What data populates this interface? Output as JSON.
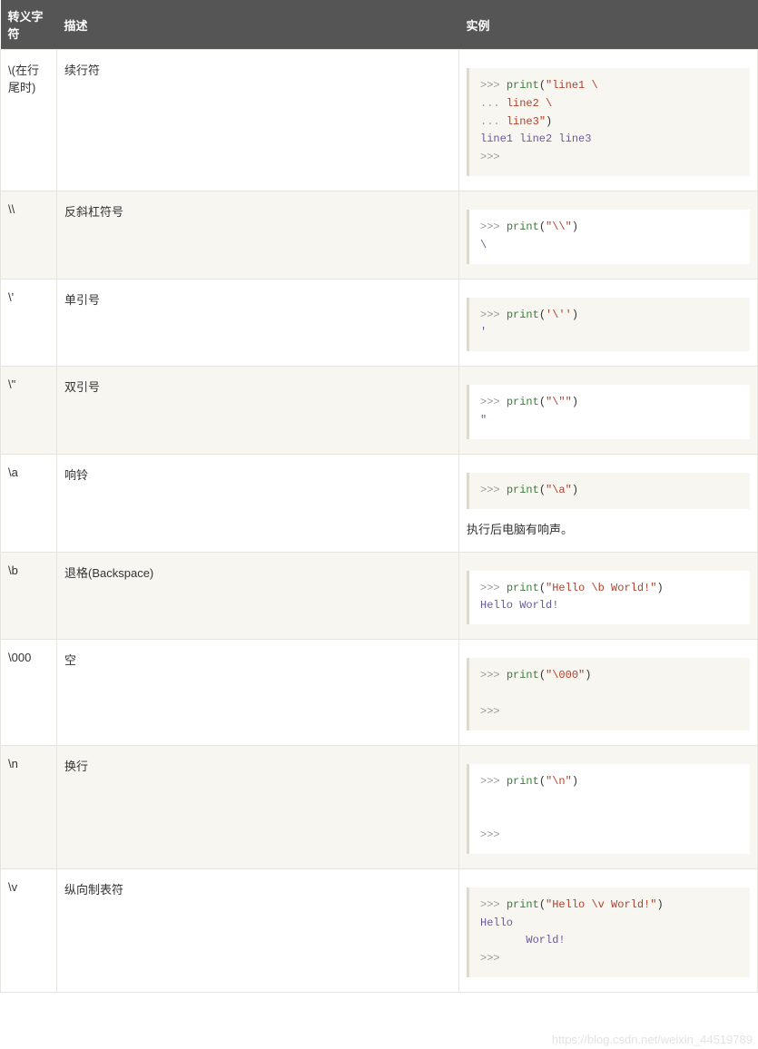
{
  "headers": {
    "c1": "转义字符",
    "c2": "描述",
    "c3": "实例"
  },
  "rows": [
    {
      "esc": "\\(在行尾时)",
      "desc": "续行符",
      "code_html": "<span class=\"tok-prompt\">&gt;&gt;&gt;</span> <span class=\"tok-fn\">print</span>(<span class=\"tok-str\">\"line1 \\</span>\n<span class=\"tok-prompt\">...</span> <span class=\"tok-str\">line2 \\</span>\n<span class=\"tok-prompt\">...</span> <span class=\"tok-str\">line3\"</span>)\n<span class=\"tok-out\">line1 line2 line3</span>\n<span class=\"tok-prompt\">&gt;&gt;&gt;</span> ",
      "note": ""
    },
    {
      "esc": "\\\\",
      "desc": "反斜杠符号",
      "code_html": "<span class=\"tok-prompt\">&gt;&gt;&gt;</span> <span class=\"tok-fn\">print</span>(<span class=\"tok-str\">\"\\\\\"</span>)\n<span class=\"tok-out\">\\</span>",
      "note": ""
    },
    {
      "esc": "\\'",
      "desc": "单引号",
      "code_html": "<span class=\"tok-prompt\">&gt;&gt;&gt;</span> <span class=\"tok-fn\">print</span>(<span class=\"tok-str\">'\\''</span>)\n<span class=\"tok-out\">'</span>",
      "note": ""
    },
    {
      "esc": "\\\"",
      "desc": "双引号",
      "code_html": "<span class=\"tok-prompt\">&gt;&gt;&gt;</span> <span class=\"tok-fn\">print</span>(<span class=\"tok-str\">\"\\\"\"</span>)\n<span class=\"tok-out\">\"</span>",
      "note": ""
    },
    {
      "esc": "\\a",
      "desc": "响铃",
      "code_html": "<span class=\"tok-prompt\">&gt;&gt;&gt;</span> <span class=\"tok-fn\">print</span>(<span class=\"tok-str\">\"\\a\"</span>)",
      "note": "执行后电脑有响声。"
    },
    {
      "esc": "\\b",
      "desc": "退格(Backspace)",
      "code_html": "<span class=\"tok-prompt\">&gt;&gt;&gt;</span> <span class=\"tok-fn\">print</span>(<span class=\"tok-str\">\"Hello \\b World!\"</span>)\n<span class=\"tok-out\">Hello World!</span>",
      "note": ""
    },
    {
      "esc": "\\000",
      "desc": "空",
      "code_html": "<span class=\"tok-prompt\">&gt;&gt;&gt;</span> <span class=\"tok-fn\">print</span>(<span class=\"tok-str\">\"\\000\"</span>)\n\n<span class=\"tok-prompt\">&gt;&gt;&gt;</span> ",
      "note": ""
    },
    {
      "esc": "\\n",
      "desc": "换行",
      "code_html": "<span class=\"tok-prompt\">&gt;&gt;&gt;</span> <span class=\"tok-fn\">print</span>(<span class=\"tok-str\">\"\\n\"</span>)\n\n\n<span class=\"tok-prompt\">&gt;&gt;&gt;</span> ",
      "note": ""
    },
    {
      "esc": "\\v",
      "desc": "纵向制表符",
      "code_html": "<span class=\"tok-prompt\">&gt;&gt;&gt;</span> <span class=\"tok-fn\">print</span>(<span class=\"tok-str\">\"Hello \\v World!\"</span>)\n<span class=\"tok-out\">Hello</span>\n<span class=\"tok-out\">       World!</span>\n<span class=\"tok-prompt\">&gt;&gt;&gt;</span> ",
      "note": ""
    }
  ],
  "watermark": "https://blog.csdn.net/weixin_44519789"
}
